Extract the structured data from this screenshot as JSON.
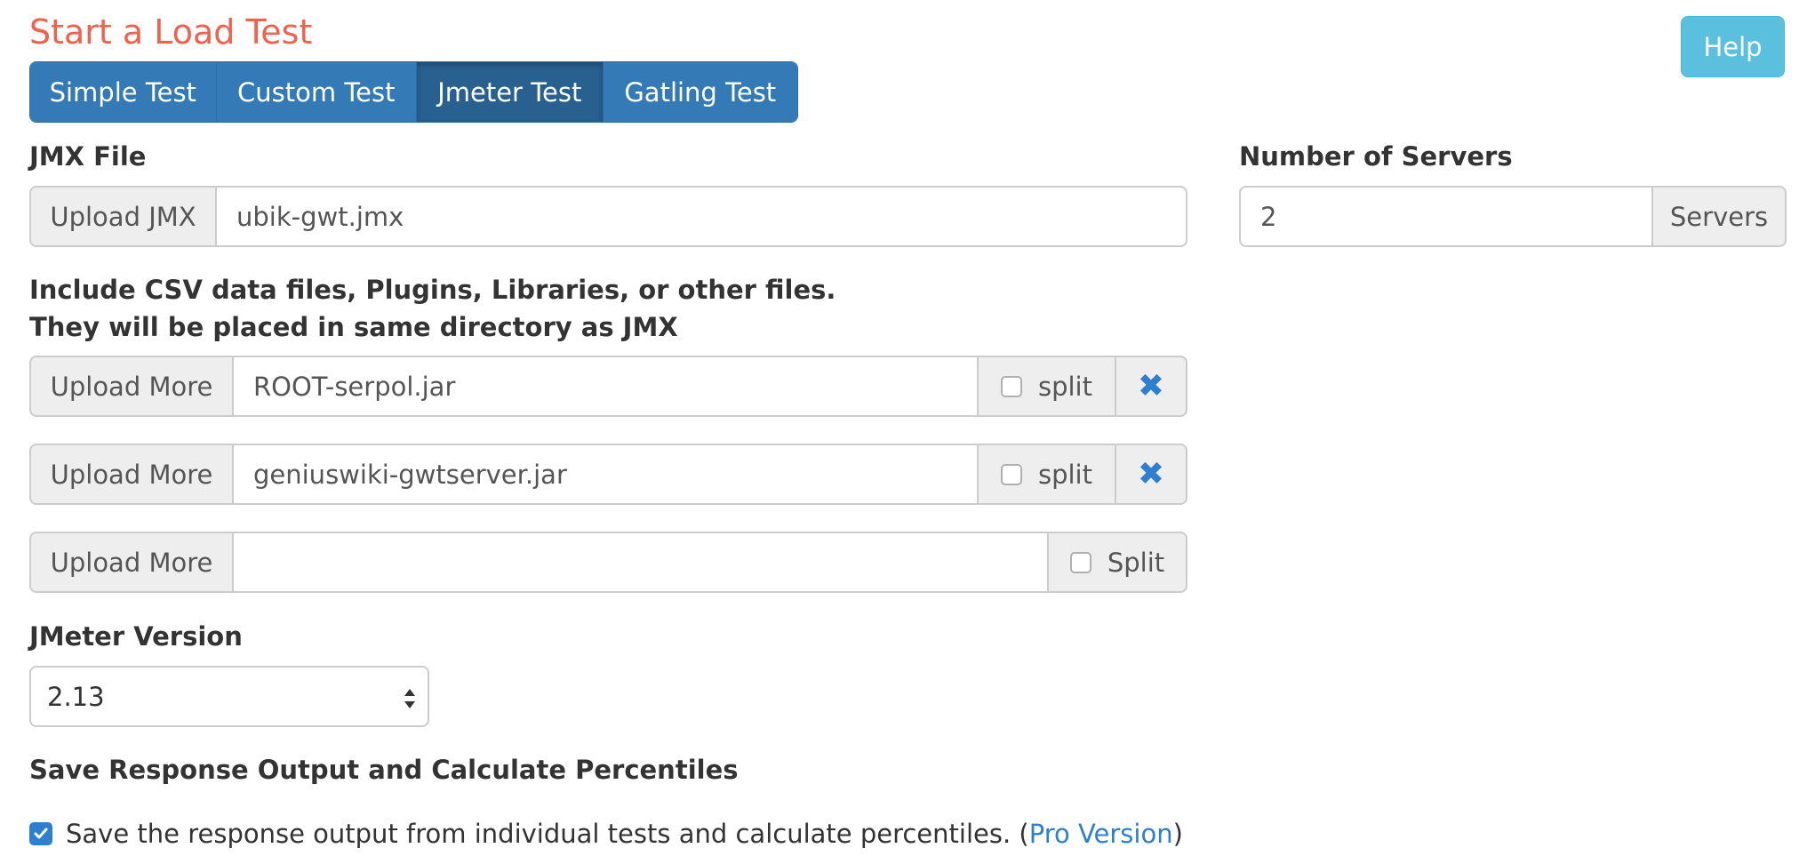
{
  "header": {
    "title": "Start a Load Test",
    "help_label": "Help"
  },
  "tabs": [
    {
      "label": "Simple Test",
      "active": false
    },
    {
      "label": "Custom Test",
      "active": false
    },
    {
      "label": "Jmeter Test",
      "active": true
    },
    {
      "label": "Gatling Test",
      "active": false
    }
  ],
  "jmx": {
    "label": "JMX File",
    "upload_label": "Upload JMX",
    "filename": "ubik-gwt.jmx"
  },
  "servers": {
    "label": "Number of Servers",
    "value": "2",
    "unit": "Servers"
  },
  "extra_files": {
    "instructions_line1": "Include CSV data files, Plugins, Libraries, or other files.",
    "instructions_line2": "They will be placed in same directory as JMX",
    "rows": [
      {
        "upload_label": "Upload More",
        "filename": "ROOT-serpol.jar",
        "split_label": "split",
        "split_checked": false
      },
      {
        "upload_label": "Upload More",
        "filename": "geniuswiki-gwtserver.jar",
        "split_label": "split",
        "split_checked": false
      },
      {
        "upload_label": "Upload More",
        "filename": "",
        "split_label": "Split",
        "split_checked": false
      }
    ],
    "remove_icon": "close-icon"
  },
  "jmeter_version": {
    "label": "JMeter Version",
    "selected": "2.13"
  },
  "save_response": {
    "heading": "Save Response Output and Calculate Percentiles",
    "checked": true,
    "text": "Save the response output from individual tests and calculate percentiles. (",
    "link_label": "Pro Version",
    "closing": ")"
  },
  "colors": {
    "title": "#f0624d",
    "primary": "#337ab7",
    "primary_active": "#286090",
    "info": "#5bc0de",
    "link": "#2e7fcf"
  }
}
